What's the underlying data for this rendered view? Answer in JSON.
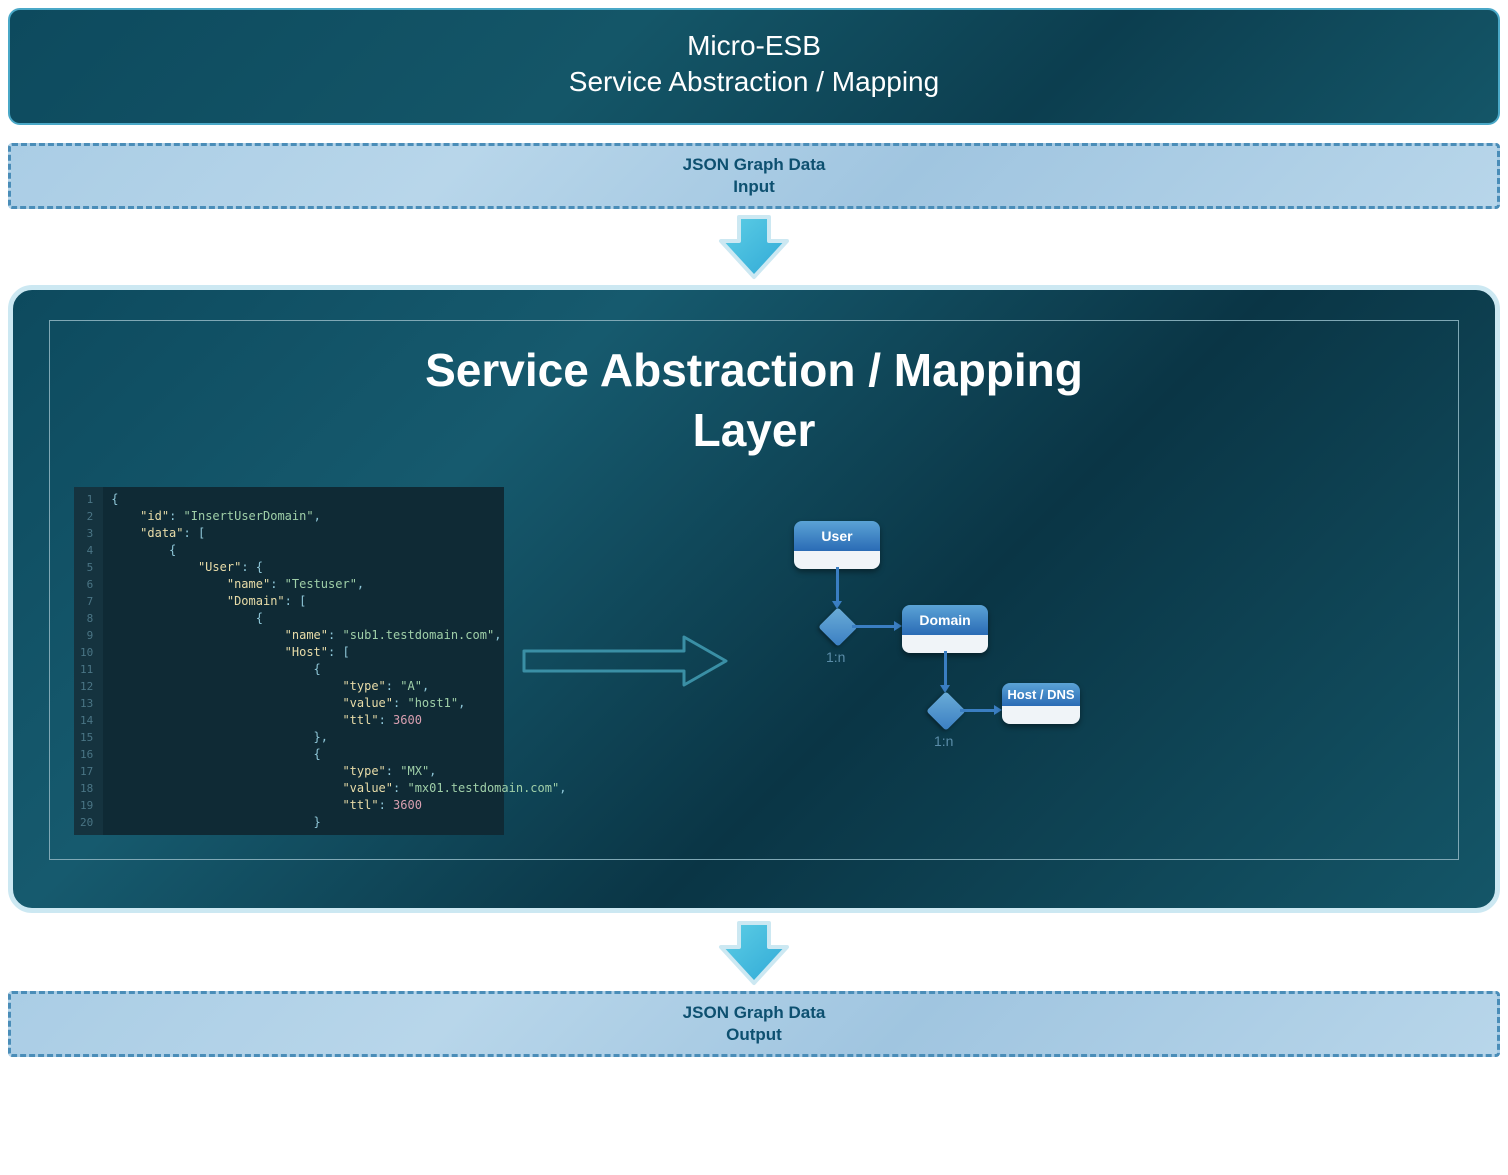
{
  "header": {
    "line1": "Micro-ESB",
    "line2": "Service Abstraction / Mapping"
  },
  "input_box": {
    "line1": "JSON Graph Data",
    "line2": "Input"
  },
  "main": {
    "title_line1": "Service Abstraction / Mapping",
    "title_line2": "Layer",
    "code": {
      "id": "InsertUserDomain",
      "user_name": "Testuser",
      "domain_name": "sub1.testdomain.com",
      "host1": {
        "type": "A",
        "value": "host1",
        "ttl": 3600
      },
      "host2": {
        "type": "MX",
        "value": "mx01.testdomain.com",
        "ttl": 3600
      }
    },
    "entities": {
      "user": "User",
      "domain": "Domain",
      "host": "Host / DNS",
      "rel1": "1:n",
      "rel2": "1:n"
    }
  },
  "output_box": {
    "line1": "JSON Graph Data",
    "line2": "Output"
  }
}
